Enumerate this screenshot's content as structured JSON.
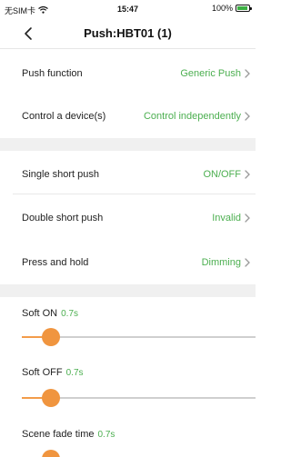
{
  "status_bar": {
    "carrier": "无SIM卡",
    "time": "15:47",
    "battery": "100%"
  },
  "nav": {
    "title": "Push:HBT01 (1)"
  },
  "settings": [
    {
      "label": "Push function",
      "value": "Generic Push"
    },
    {
      "label": "Control a device(s)",
      "value": "Control independently"
    },
    {
      "label": "Single short push",
      "value": "ON/OFF"
    },
    {
      "label": "Double short push",
      "value": "Invalid"
    },
    {
      "label": "Press and hold",
      "value": "Dimming"
    }
  ],
  "sliders": [
    {
      "label": "Soft ON",
      "value": "0.7s",
      "level_fraction": 0.07
    },
    {
      "label": "Soft OFF",
      "value": "0.7s",
      "level_fraction": 0.07
    },
    {
      "label": "Scene fade time",
      "value": "0.7s",
      "level_fraction": 0.07
    }
  ],
  "colors": {
    "accent_green": "#4caf50",
    "slider_orange": "#f0953f"
  }
}
